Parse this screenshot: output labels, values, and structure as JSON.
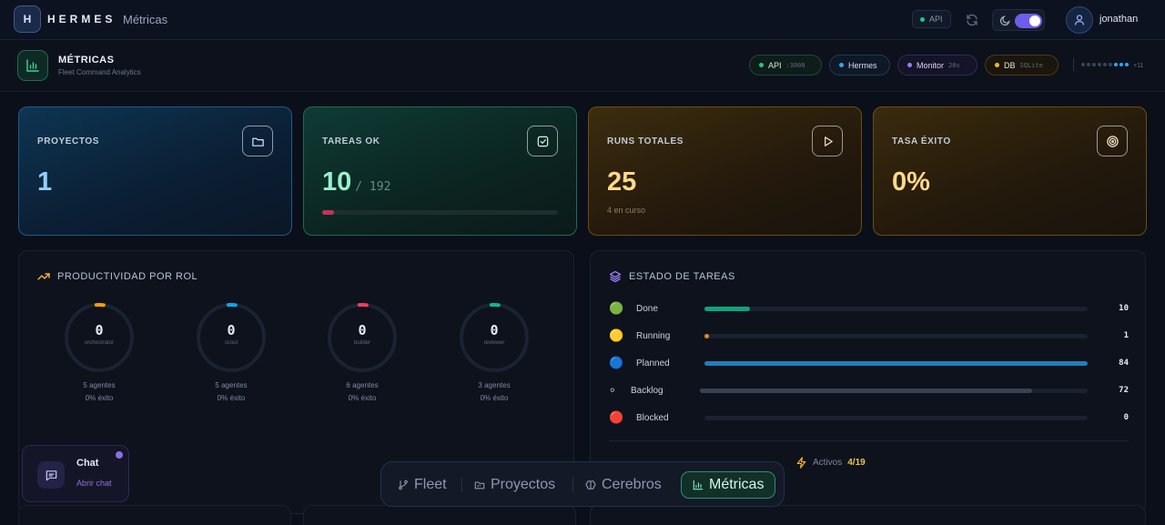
{
  "topnav": {
    "logo_letter": "H",
    "brand": "HERMES",
    "current_section": "Métricas",
    "api_label": "API",
    "username": "jonathan"
  },
  "subheader": {
    "title": "MÉTRICAS",
    "subtitle": "Fleet Command Analytics",
    "pills": {
      "api": {
        "label": "API",
        "sub": ":3000",
        "color": "#22c58b"
      },
      "hermes": {
        "label": "Hermes",
        "color": "#2aa7ff"
      },
      "monitor": {
        "label": "Monitor",
        "sub": "20s",
        "color": "#9b7cf5"
      },
      "db": {
        "label": "DB",
        "sub": "SQLite",
        "color": "#f2b632"
      }
    },
    "extra_count": "+11"
  },
  "cards": {
    "proyectos": {
      "label": "PROYECTOS",
      "value": "1",
      "icon": "folder-icon"
    },
    "tareas": {
      "label": "TAREAS OK",
      "value": "10",
      "total": "/ 192",
      "progress": 0.052,
      "icon": "check-square-icon"
    },
    "runs": {
      "label": "RUNS TOTALES",
      "value": "25",
      "note": "4 en curso",
      "icon": "play-icon"
    },
    "tasa": {
      "label": "TASA ÉXITO",
      "value": "0%",
      "icon": "target-icon"
    }
  },
  "productividad": {
    "title": "PRODUCTIVIDAD POR ROL",
    "roles": [
      {
        "value": "0",
        "role": "orchestrator",
        "agents": "5 agentes",
        "success": "0% éxito",
        "color": "#f59e0b"
      },
      {
        "value": "0",
        "role": "scout",
        "agents": "5 agentes",
        "success": "0% éxito",
        "color": "#0ea5e9"
      },
      {
        "value": "0",
        "role": "builder",
        "agents": "6 agentes",
        "success": "0% éxito",
        "color": "#f43f5e"
      },
      {
        "value": "0",
        "role": "reviewer",
        "agents": "3 agentes",
        "success": "0% éxito",
        "color": "#10b981"
      }
    ]
  },
  "estado": {
    "title": "ESTADO DE TAREAS",
    "rows": [
      {
        "emoji": "🟢",
        "label": "Done",
        "count": "10",
        "fraction": 0.119,
        "color": "#10a37a"
      },
      {
        "emoji": "🟡",
        "label": "Running",
        "count": "1",
        "fraction": 0.012,
        "color": "#e08a1e"
      },
      {
        "emoji": "🔵",
        "label": "Planned",
        "count": "84",
        "fraction": 1.0,
        "color": "#1f7fb8"
      },
      {
        "emoji": "⚪",
        "label": "Backlog",
        "count": "72",
        "fraction": 0.857,
        "color": "#3a4354"
      },
      {
        "emoji": "🔴",
        "label": "Blocked",
        "count": "0",
        "fraction": 0.0,
        "color": "#e0344d"
      }
    ],
    "footer": {
      "activos_label": "Activos",
      "activos_value": "4/19"
    }
  },
  "chat": {
    "title": "Chat",
    "subtitle": "Abrir chat"
  },
  "bottom_nav": {
    "fleet": "Fleet",
    "proyectos": "Proyectos",
    "cerebros": "Cerebros",
    "metricas": "Métricas"
  }
}
